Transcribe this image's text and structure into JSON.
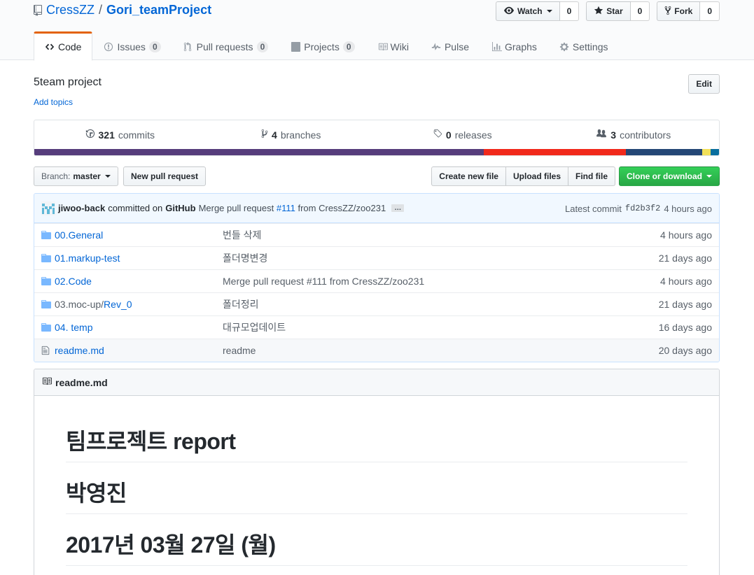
{
  "repo": {
    "owner": "CressZZ",
    "separator": "/",
    "name": "Gori_teamProject",
    "description": "5team project",
    "add_topics": "Add topics",
    "edit_label": "Edit"
  },
  "actions": {
    "watch": {
      "label": "Watch",
      "count": "0"
    },
    "star": {
      "label": "Star",
      "count": "0"
    },
    "fork": {
      "label": "Fork",
      "count": "0"
    }
  },
  "nav": {
    "tabs": [
      {
        "label": "Code",
        "icon": "code-icon",
        "counter": ""
      },
      {
        "label": "Issues",
        "icon": "issue-icon",
        "counter": "0"
      },
      {
        "label": "Pull requests",
        "icon": "pull-request-icon",
        "counter": "0"
      },
      {
        "label": "Projects",
        "icon": "project-icon",
        "counter": "0"
      },
      {
        "label": "Wiki",
        "icon": "book-icon",
        "counter": ""
      },
      {
        "label": "Pulse",
        "icon": "pulse-icon",
        "counter": ""
      },
      {
        "label": "Graphs",
        "icon": "graph-icon",
        "counter": ""
      },
      {
        "label": "Settings",
        "icon": "gear-icon",
        "counter": ""
      }
    ]
  },
  "summary": {
    "commits": {
      "num": "321",
      "label": "commits"
    },
    "branches": {
      "num": "4",
      "label": "branches"
    },
    "releases": {
      "num": "0",
      "label": "releases"
    },
    "contributors": {
      "num": "3",
      "label": "contributors"
    }
  },
  "languages": [
    {
      "color": "#563d7c",
      "share": 65.6
    },
    {
      "color": "#f1291b",
      "share": 20.8
    },
    {
      "color": "#244776",
      "share": 11.1
    },
    {
      "color": "#f1e05a",
      "share": 1.3
    },
    {
      "color": "#0a6e9e",
      "share": 1.2
    }
  ],
  "file_nav": {
    "branch_label": "Branch:",
    "branch_name": "master",
    "new_pr": "New pull request",
    "create_file": "Create new file",
    "upload_files": "Upload files",
    "find_file": "Find file",
    "clone": "Clone or download"
  },
  "commit": {
    "author": "jiwoo-back",
    "committed_on": "committed on",
    "platform": "GitHub",
    "message_prefix": "Merge pull request",
    "pr_link": "#111",
    "message_suffix": "from CressZZ/zoo231",
    "ellipsis": "…",
    "latest_label": "Latest commit",
    "sha": "fd2b3f2",
    "age": "4 hours ago"
  },
  "files": [
    {
      "type": "folder",
      "name_plain": "",
      "name": "00.General",
      "message": "번들 삭제",
      "age": "4 hours ago"
    },
    {
      "type": "folder",
      "name_plain": "",
      "name": "01.markup-test",
      "message": "폴더명변경",
      "age": "21 days ago"
    },
    {
      "type": "folder",
      "name_plain": "",
      "name": "02.Code",
      "message": "Merge pull request #111 from CressZZ/zoo231",
      "age": "4 hours ago"
    },
    {
      "type": "folder",
      "name_plain": "03.moc-up/",
      "name": "Rev_0",
      "message": "폴더정리",
      "age": "21 days ago"
    },
    {
      "type": "folder",
      "name_plain": "",
      "name": "04. temp",
      "message": "대규모업데이트",
      "age": "16 days ago"
    },
    {
      "type": "file",
      "name_plain": "",
      "name": "readme.md",
      "message": "readme",
      "age": "20 days ago"
    }
  ],
  "readme": {
    "filename": "readme.md",
    "headings": [
      "팀프로젝트 report",
      "박영진",
      "2017년 03월 27일 (월)"
    ]
  }
}
